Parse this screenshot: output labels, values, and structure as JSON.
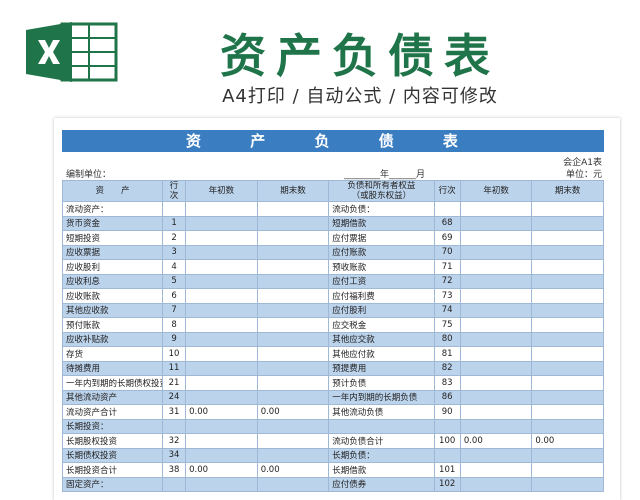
{
  "header": {
    "title": "资产负债表",
    "subtitle": "A4打印 / 自动公式 / 内容可修改"
  },
  "sheet": {
    "title": "资 产 负 债 表",
    "code": "会企A1表",
    "company_label": "编制单位：",
    "date_label": "________年______月",
    "unit_label": "单位：元",
    "headers": {
      "asset": "资　　产",
      "line": "行次",
      "begin": "年初数",
      "end": "期末数",
      "liab": "负债和所有者权益",
      "liab2": "（或股东权益）",
      "line2": "行次",
      "begin2": "年初数",
      "end2": "期末数"
    },
    "rows": [
      {
        "a": "流动资产：",
        "n": "",
        "b": "",
        "e": "",
        "l": "流动负债：",
        "ln": "",
        "lb": "",
        "le": "",
        "sa": false,
        "sl": false
      },
      {
        "a": "货币资金",
        "n": "1",
        "b": "",
        "e": "",
        "l": "短期借款",
        "ln": "68",
        "lb": "",
        "le": "",
        "sa": true,
        "sl": true
      },
      {
        "a": "短期投资",
        "n": "2",
        "b": "",
        "e": "",
        "l": "应付票据",
        "ln": "69",
        "lb": "",
        "le": "",
        "sa": true,
        "sl": true
      },
      {
        "a": "应收票据",
        "n": "3",
        "b": "",
        "e": "",
        "l": "应付账款",
        "ln": "70",
        "lb": "",
        "le": "",
        "sa": true,
        "sl": true
      },
      {
        "a": "应收股利",
        "n": "4",
        "b": "",
        "e": "",
        "l": "预收账款",
        "ln": "71",
        "lb": "",
        "le": "",
        "sa": true,
        "sl": true
      },
      {
        "a": "应收利息",
        "n": "5",
        "b": "",
        "e": "",
        "l": "应付工资",
        "ln": "72",
        "lb": "",
        "le": "",
        "sa": true,
        "sl": true
      },
      {
        "a": "应收账款",
        "n": "6",
        "b": "",
        "e": "",
        "l": "应付福利费",
        "ln": "73",
        "lb": "",
        "le": "",
        "sa": true,
        "sl": true
      },
      {
        "a": "其他应收款",
        "n": "7",
        "b": "",
        "e": "",
        "l": "应付股利",
        "ln": "74",
        "lb": "",
        "le": "",
        "sa": true,
        "sl": true
      },
      {
        "a": "预付账款",
        "n": "8",
        "b": "",
        "e": "",
        "l": "应交税金",
        "ln": "75",
        "lb": "",
        "le": "",
        "sa": true,
        "sl": true
      },
      {
        "a": "应收补贴款",
        "n": "9",
        "b": "",
        "e": "",
        "l": "其他应交款",
        "ln": "80",
        "lb": "",
        "le": "",
        "sa": true,
        "sl": true
      },
      {
        "a": "存货",
        "n": "10",
        "b": "",
        "e": "",
        "l": "其他应付款",
        "ln": "81",
        "lb": "",
        "le": "",
        "sa": false,
        "sl": true
      },
      {
        "a": "待摊费用",
        "n": "11",
        "b": "",
        "e": "",
        "l": "预提费用",
        "ln": "82",
        "lb": "",
        "le": "",
        "sa": true,
        "sl": true
      },
      {
        "a": "一年内到期的长期债权投资",
        "n": "21",
        "b": "",
        "e": "",
        "l": "预计负债",
        "ln": "83",
        "lb": "",
        "le": "",
        "sa": false,
        "sl": true
      },
      {
        "a": "其他流动资产",
        "n": "24",
        "b": "",
        "e": "",
        "l": "一年内到期的长期负债",
        "ln": "86",
        "lb": "",
        "le": "",
        "sa": true,
        "sl": false
      },
      {
        "a": "流动资产合计",
        "n": "31",
        "b": "0.00",
        "e": "0.00",
        "l": "其他流动负债",
        "ln": "90",
        "lb": "",
        "le": "",
        "sa": false,
        "sl": true
      },
      {
        "a": "长期投资：",
        "n": "",
        "b": "",
        "e": "",
        "l": "",
        "ln": "",
        "lb": "",
        "le": "",
        "sa": false,
        "sl": false
      },
      {
        "a": "长期股权投资",
        "n": "32",
        "b": "",
        "e": "",
        "l": "流动负债合计",
        "ln": "100",
        "lb": "0.00",
        "le": "0.00",
        "sa": true,
        "sl": true
      },
      {
        "a": "长期债权投资",
        "n": "34",
        "b": "",
        "e": "",
        "l": "长期负债：",
        "ln": "",
        "lb": "",
        "le": "",
        "sa": true,
        "sl": false
      },
      {
        "a": "长期投资合计",
        "n": "38",
        "b": "0.00",
        "e": "0.00",
        "l": "长期借款",
        "ln": "101",
        "lb": "",
        "le": "",
        "sa": true,
        "sl": true
      },
      {
        "a": "固定资产：",
        "n": "",
        "b": "",
        "e": "",
        "l": "应付债券",
        "ln": "102",
        "lb": "",
        "le": "",
        "sa": false,
        "sl": true
      }
    ]
  }
}
